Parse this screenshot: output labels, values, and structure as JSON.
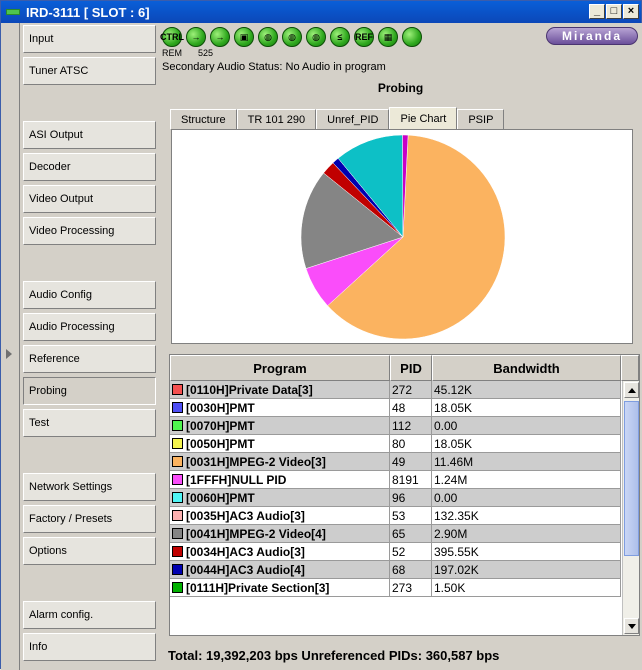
{
  "window": {
    "title": "IRD-3111 [ SLOT : 6]",
    "buttons": [
      "_",
      "□",
      "×"
    ]
  },
  "sidebar": {
    "items": [
      {
        "label": "Input"
      },
      {
        "label": "Tuner ATSC"
      },
      {
        "label": "ASI Output"
      },
      {
        "label": "Decoder"
      },
      {
        "label": "Video Output"
      },
      {
        "label": "Video Processing"
      },
      {
        "label": "Audio Config"
      },
      {
        "label": "Audio Processing"
      },
      {
        "label": "Reference"
      },
      {
        "label": "Probing"
      },
      {
        "label": "Test"
      },
      {
        "label": "Network Settings"
      },
      {
        "label": "Factory / Presets"
      },
      {
        "label": "Options"
      },
      {
        "label": "Alarm config."
      },
      {
        "label": "Info"
      }
    ],
    "active": "Probing"
  },
  "toolbar": {
    "icons": [
      "ctrl-icon",
      "arrow-right-icon",
      "arrow-right-icon",
      "film-icon",
      "speaker-icon",
      "speaker-icon",
      "audio-lock-icon",
      "less-equal-icon",
      "ref-icon",
      "video-icon",
      "status-green-icon"
    ],
    "icon_texts": [
      "CTRL",
      "→",
      "→",
      "▣",
      "◍",
      "◍",
      "◍",
      "≤",
      "REF",
      "▦",
      ""
    ],
    "rem_label": "REM",
    "num_label": "525",
    "logo_text": "Miranda"
  },
  "status": {
    "secondary_audio": "Secondary Audio Status: No Audio in program"
  },
  "probing": {
    "title": "Probing",
    "tabs": [
      "Structure",
      "TR 101 290",
      "Unref_PID",
      "Pie Chart",
      "PSIP"
    ],
    "active_tab": "Pie Chart"
  },
  "chart_data": {
    "type": "pie",
    "slices": [
      {
        "label": "[0031H]MPEG-2 Video[3]",
        "value": 11.46,
        "color": "#fbb360"
      },
      {
        "label": "[1FFFH]NULL PID",
        "value": 1.24,
        "color": "#fa4dfa"
      },
      {
        "label": "[0041H]MPEG-2 Video[4]",
        "value": 2.9,
        "color": "#858585"
      },
      {
        "label": "[0034H]AC3 Audio[3]",
        "value": 0.39555,
        "color": "#c00000"
      },
      {
        "label": "[0044H]AC3 Audio[4]",
        "value": 0.19702,
        "color": "#0000b0"
      },
      {
        "label": "[0035H]AC3 Audio[3]",
        "value": 2.0,
        "color": "#0dc0c6"
      },
      {
        "label": "[0110H]Private Data[3]",
        "value": 0.16,
        "color": "#c800c8"
      }
    ]
  },
  "table": {
    "headers": [
      "Program",
      "PID",
      "Bandwidth"
    ],
    "rows": [
      {
        "program": "[0110H]Private Data[3]",
        "pid": "272",
        "bw": "45.12K",
        "color": "#f45050"
      },
      {
        "program": "[0030H]PMT",
        "pid": "48",
        "bw": "18.05K",
        "color": "#4f4ff5"
      },
      {
        "program": "[0070H]PMT",
        "pid": "112",
        "bw": "0.00",
        "color": "#4ff54f"
      },
      {
        "program": "[0050H]PMT",
        "pid": "80",
        "bw": "18.05K",
        "color": "#f5f54f"
      },
      {
        "program": "[0031H]MPEG-2 Video[3]",
        "pid": "49",
        "bw": "11.46M",
        "color": "#fbb360"
      },
      {
        "program": "[1FFFH]NULL PID",
        "pid": "8191",
        "bw": "1.24M",
        "color": "#fa4dfa"
      },
      {
        "program": "[0060H]PMT",
        "pid": "96",
        "bw": "0.00",
        "color": "#4ff5f5"
      },
      {
        "program": "[0035H]AC3 Audio[3]",
        "pid": "53",
        "bw": "132.35K",
        "color": "#fbb0b0"
      },
      {
        "program": "[0041H]MPEG-2 Video[4]",
        "pid": "65",
        "bw": "2.90M",
        "color": "#858585"
      },
      {
        "program": "[0034H]AC3 Audio[3]",
        "pid": "52",
        "bw": "395.55K",
        "color": "#c00000"
      },
      {
        "program": "[0044H]AC3 Audio[4]",
        "pid": "68",
        "bw": "197.02K",
        "color": "#0000b0"
      },
      {
        "program": "[0111H]Private Section[3]",
        "pid": "273",
        "bw": "1.50K",
        "color": "#00b000"
      }
    ]
  },
  "footer": {
    "total": "Total: 19,392,203 bps   Unreferenced PIDs: 360,587 bps"
  }
}
